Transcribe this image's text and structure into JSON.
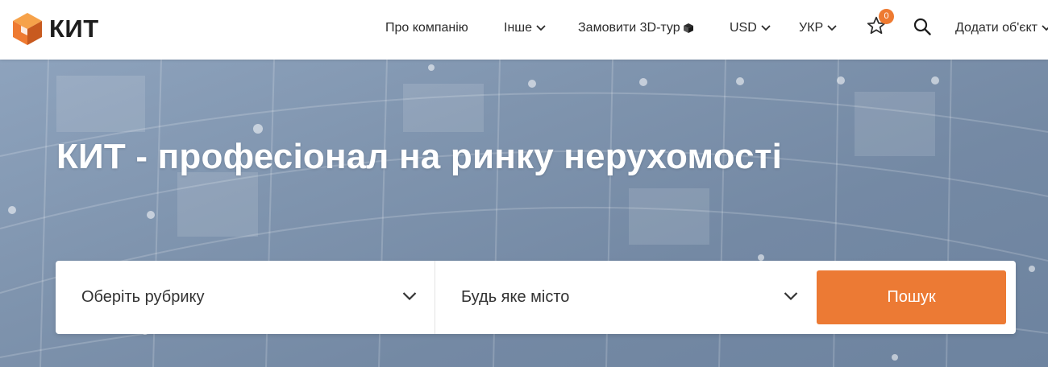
{
  "brand": {
    "name": "КИТ",
    "logo_icon": "cube-logo-icon",
    "colors": {
      "orange": "#ee7a31",
      "dark_orange": "#c85a1f"
    }
  },
  "nav": {
    "about": "Про компанію",
    "other": "Інше",
    "tour": "Замовити 3D-тур",
    "currency": "USD",
    "language": "УКР",
    "favorites_count": "0",
    "add_object": "Додати об'єкт"
  },
  "hero": {
    "title": "КИТ - професіонал на ринку нерухомості"
  },
  "search": {
    "category_placeholder": "Оберіть рубрику",
    "city_placeholder": "Будь яке місто",
    "button": "Пошук"
  },
  "colors": {
    "accent": "#ec7a34",
    "text": "#2b2b2b",
    "hero_bg": "#7f94ae"
  }
}
